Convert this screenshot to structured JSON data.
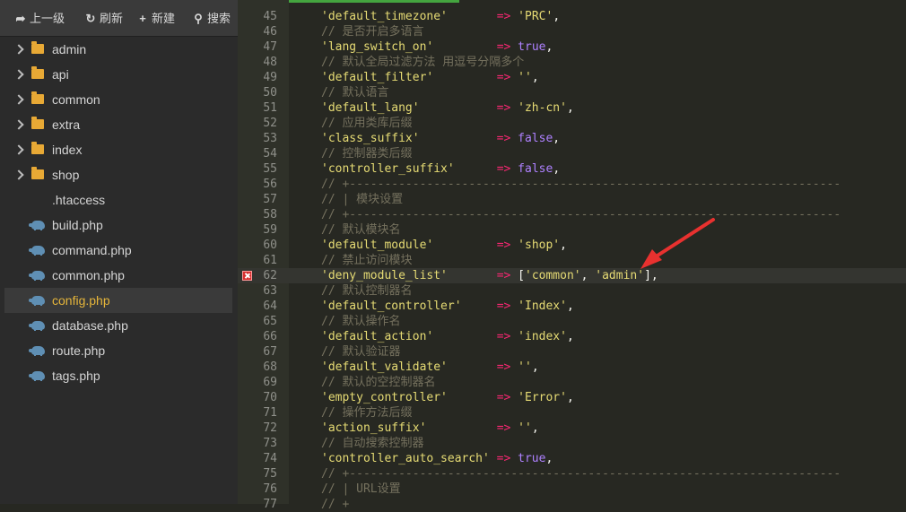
{
  "toolbar": {
    "up_label": "上一级",
    "refresh_label": "刷新",
    "new_label": "新建",
    "search_label": "搜索"
  },
  "file_tree": {
    "selected": "config.php",
    "items": [
      {
        "label": "admin",
        "type": "folder",
        "icon": "folder-icon"
      },
      {
        "label": "api",
        "type": "folder",
        "icon": "folder-icon"
      },
      {
        "label": "common",
        "type": "folder",
        "icon": "folder-icon"
      },
      {
        "label": "extra",
        "type": "folder",
        "icon": "folder-icon"
      },
      {
        "label": "index",
        "type": "folder",
        "icon": "folder-icon"
      },
      {
        "label": "shop",
        "type": "folder",
        "icon": "folder-icon"
      },
      {
        "label": ".htaccess",
        "type": "file",
        "icon": "none"
      },
      {
        "label": "build.php",
        "type": "file",
        "icon": "php-elephant-icon"
      },
      {
        "label": "command.php",
        "type": "file",
        "icon": "php-elephant-icon"
      },
      {
        "label": "common.php",
        "type": "file",
        "icon": "php-elephant-icon"
      },
      {
        "label": "config.php",
        "type": "file",
        "icon": "php-elephant-icon"
      },
      {
        "label": "database.php",
        "type": "file",
        "icon": "php-elephant-icon"
      },
      {
        "label": "route.php",
        "type": "file",
        "icon": "php-elephant-icon"
      },
      {
        "label": "tags.php",
        "type": "file",
        "icon": "php-elephant-icon"
      }
    ]
  },
  "colors": {
    "string": "#e6db74",
    "comment": "#75715e",
    "operator": "#f92672",
    "keyword": "#ae81ff",
    "selected_file": "#e5b53a",
    "error_marker": "#d62e2e",
    "annotation_arrow": "#e8312f"
  },
  "editor": {
    "error_line": 62,
    "lines": [
      {
        "n": 45,
        "tokens": [
          [
            "s",
            "'default_timezone'"
          ],
          [
            "p",
            "       "
          ],
          [
            "o",
            "=>"
          ],
          [
            "p",
            " "
          ],
          [
            "s",
            "'PRC'"
          ],
          [
            "p",
            ","
          ]
        ]
      },
      {
        "n": 46,
        "tokens": [
          [
            "c",
            "// 是否开启多语言"
          ]
        ]
      },
      {
        "n": 47,
        "tokens": [
          [
            "s",
            "'lang_switch_on'"
          ],
          [
            "p",
            "         "
          ],
          [
            "o",
            "=>"
          ],
          [
            "p",
            " "
          ],
          [
            "k",
            "true"
          ],
          [
            "p",
            ","
          ]
        ]
      },
      {
        "n": 48,
        "tokens": [
          [
            "c",
            "// 默认全局过滤方法 用逗号分隔多个"
          ]
        ]
      },
      {
        "n": 49,
        "tokens": [
          [
            "s",
            "'default_filter'"
          ],
          [
            "p",
            "         "
          ],
          [
            "o",
            "=>"
          ],
          [
            "p",
            " "
          ],
          [
            "s",
            "''"
          ],
          [
            "p",
            ","
          ]
        ]
      },
      {
        "n": 50,
        "tokens": [
          [
            "c",
            "// 默认语言"
          ]
        ]
      },
      {
        "n": 51,
        "tokens": [
          [
            "s",
            "'default_lang'"
          ],
          [
            "p",
            "           "
          ],
          [
            "o",
            "=>"
          ],
          [
            "p",
            " "
          ],
          [
            "s",
            "'zh-cn'"
          ],
          [
            "p",
            ","
          ]
        ]
      },
      {
        "n": 52,
        "tokens": [
          [
            "c",
            "// 应用类库后缀"
          ]
        ]
      },
      {
        "n": 53,
        "tokens": [
          [
            "s",
            "'class_suffix'"
          ],
          [
            "p",
            "           "
          ],
          [
            "o",
            "=>"
          ],
          [
            "p",
            " "
          ],
          [
            "k",
            "false"
          ],
          [
            "p",
            ","
          ]
        ]
      },
      {
        "n": 54,
        "tokens": [
          [
            "c",
            "// 控制器类后缀"
          ]
        ]
      },
      {
        "n": 55,
        "tokens": [
          [
            "s",
            "'controller_suffix'"
          ],
          [
            "p",
            "      "
          ],
          [
            "o",
            "=>"
          ],
          [
            "p",
            " "
          ],
          [
            "k",
            "false"
          ],
          [
            "p",
            ","
          ]
        ]
      },
      {
        "n": 56,
        "tokens": [
          [
            "c",
            "// +----------------------------------------------------------------------"
          ]
        ]
      },
      {
        "n": 57,
        "tokens": [
          [
            "c",
            "// | 模块设置"
          ]
        ]
      },
      {
        "n": 58,
        "tokens": [
          [
            "c",
            "// +----------------------------------------------------------------------"
          ]
        ]
      },
      {
        "n": 59,
        "tokens": [
          [
            "c",
            "// 默认模块名"
          ]
        ]
      },
      {
        "n": 60,
        "tokens": [
          [
            "s",
            "'default_module'"
          ],
          [
            "p",
            "         "
          ],
          [
            "o",
            "=>"
          ],
          [
            "p",
            " "
          ],
          [
            "s",
            "'shop'"
          ],
          [
            "p",
            ","
          ]
        ]
      },
      {
        "n": 61,
        "tokens": [
          [
            "c",
            "// 禁止访问模块"
          ]
        ]
      },
      {
        "n": 62,
        "tokens": [
          [
            "s",
            "'deny_module_list'"
          ],
          [
            "p",
            "       "
          ],
          [
            "o",
            "=>"
          ],
          [
            "p",
            " ["
          ],
          [
            "s",
            "'common'"
          ],
          [
            "p",
            ", "
          ],
          [
            "s",
            "'admin'"
          ],
          [
            "p",
            "],"
          ]
        ]
      },
      {
        "n": 63,
        "tokens": [
          [
            "c",
            "// 默认控制器名"
          ]
        ]
      },
      {
        "n": 64,
        "tokens": [
          [
            "s",
            "'default_controller'"
          ],
          [
            "p",
            "     "
          ],
          [
            "o",
            "=>"
          ],
          [
            "p",
            " "
          ],
          [
            "s",
            "'Index'"
          ],
          [
            "p",
            ","
          ]
        ]
      },
      {
        "n": 65,
        "tokens": [
          [
            "c",
            "// 默认操作名"
          ]
        ]
      },
      {
        "n": 66,
        "tokens": [
          [
            "s",
            "'default_action'"
          ],
          [
            "p",
            "         "
          ],
          [
            "o",
            "=>"
          ],
          [
            "p",
            " "
          ],
          [
            "s",
            "'index'"
          ],
          [
            "p",
            ","
          ]
        ]
      },
      {
        "n": 67,
        "tokens": [
          [
            "c",
            "// 默认验证器"
          ]
        ]
      },
      {
        "n": 68,
        "tokens": [
          [
            "s",
            "'default_validate'"
          ],
          [
            "p",
            "       "
          ],
          [
            "o",
            "=>"
          ],
          [
            "p",
            " "
          ],
          [
            "s",
            "''"
          ],
          [
            "p",
            ","
          ]
        ]
      },
      {
        "n": 69,
        "tokens": [
          [
            "c",
            "// 默认的空控制器名"
          ]
        ]
      },
      {
        "n": 70,
        "tokens": [
          [
            "s",
            "'empty_controller'"
          ],
          [
            "p",
            "       "
          ],
          [
            "o",
            "=>"
          ],
          [
            "p",
            " "
          ],
          [
            "s",
            "'Error'"
          ],
          [
            "p",
            ","
          ]
        ]
      },
      {
        "n": 71,
        "tokens": [
          [
            "c",
            "// 操作方法后缀"
          ]
        ]
      },
      {
        "n": 72,
        "tokens": [
          [
            "s",
            "'action_suffix'"
          ],
          [
            "p",
            "          "
          ],
          [
            "o",
            "=>"
          ],
          [
            "p",
            " "
          ],
          [
            "s",
            "''"
          ],
          [
            "p",
            ","
          ]
        ]
      },
      {
        "n": 73,
        "tokens": [
          [
            "c",
            "// 自动搜索控制器"
          ]
        ]
      },
      {
        "n": 74,
        "tokens": [
          [
            "s",
            "'controller_auto_search'"
          ],
          [
            "p",
            " "
          ],
          [
            "o",
            "=>"
          ],
          [
            "p",
            " "
          ],
          [
            "k",
            "true"
          ],
          [
            "p",
            ","
          ]
        ]
      },
      {
        "n": 75,
        "tokens": [
          [
            "c",
            "// +----------------------------------------------------------------------"
          ]
        ]
      },
      {
        "n": 76,
        "tokens": [
          [
            "c",
            "// | URL设置"
          ]
        ]
      },
      {
        "n": 77,
        "tokens": [
          [
            "c",
            "// +"
          ]
        ]
      }
    ]
  }
}
